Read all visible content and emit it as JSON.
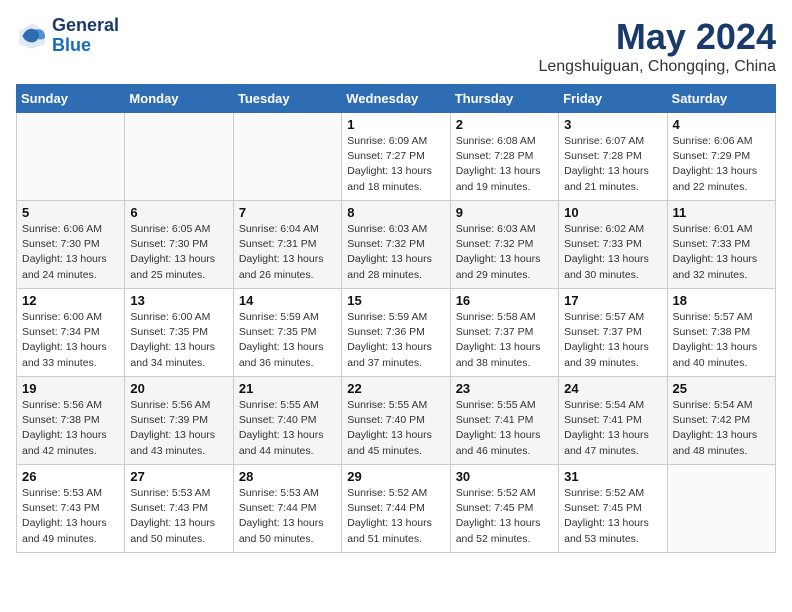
{
  "header": {
    "logo_line1": "General",
    "logo_line2": "Blue",
    "month_year": "May 2024",
    "location": "Lengshuiguan, Chongqing, China"
  },
  "days_of_week": [
    "Sunday",
    "Monday",
    "Tuesday",
    "Wednesday",
    "Thursday",
    "Friday",
    "Saturday"
  ],
  "weeks": [
    [
      {
        "day": "",
        "info": ""
      },
      {
        "day": "",
        "info": ""
      },
      {
        "day": "",
        "info": ""
      },
      {
        "day": "1",
        "info": "Sunrise: 6:09 AM\nSunset: 7:27 PM\nDaylight: 13 hours\nand 18 minutes."
      },
      {
        "day": "2",
        "info": "Sunrise: 6:08 AM\nSunset: 7:28 PM\nDaylight: 13 hours\nand 19 minutes."
      },
      {
        "day": "3",
        "info": "Sunrise: 6:07 AM\nSunset: 7:28 PM\nDaylight: 13 hours\nand 21 minutes."
      },
      {
        "day": "4",
        "info": "Sunrise: 6:06 AM\nSunset: 7:29 PM\nDaylight: 13 hours\nand 22 minutes."
      }
    ],
    [
      {
        "day": "5",
        "info": "Sunrise: 6:06 AM\nSunset: 7:30 PM\nDaylight: 13 hours\nand 24 minutes."
      },
      {
        "day": "6",
        "info": "Sunrise: 6:05 AM\nSunset: 7:30 PM\nDaylight: 13 hours\nand 25 minutes."
      },
      {
        "day": "7",
        "info": "Sunrise: 6:04 AM\nSunset: 7:31 PM\nDaylight: 13 hours\nand 26 minutes."
      },
      {
        "day": "8",
        "info": "Sunrise: 6:03 AM\nSunset: 7:32 PM\nDaylight: 13 hours\nand 28 minutes."
      },
      {
        "day": "9",
        "info": "Sunrise: 6:03 AM\nSunset: 7:32 PM\nDaylight: 13 hours\nand 29 minutes."
      },
      {
        "day": "10",
        "info": "Sunrise: 6:02 AM\nSunset: 7:33 PM\nDaylight: 13 hours\nand 30 minutes."
      },
      {
        "day": "11",
        "info": "Sunrise: 6:01 AM\nSunset: 7:33 PM\nDaylight: 13 hours\nand 32 minutes."
      }
    ],
    [
      {
        "day": "12",
        "info": "Sunrise: 6:00 AM\nSunset: 7:34 PM\nDaylight: 13 hours\nand 33 minutes."
      },
      {
        "day": "13",
        "info": "Sunrise: 6:00 AM\nSunset: 7:35 PM\nDaylight: 13 hours\nand 34 minutes."
      },
      {
        "day": "14",
        "info": "Sunrise: 5:59 AM\nSunset: 7:35 PM\nDaylight: 13 hours\nand 36 minutes."
      },
      {
        "day": "15",
        "info": "Sunrise: 5:59 AM\nSunset: 7:36 PM\nDaylight: 13 hours\nand 37 minutes."
      },
      {
        "day": "16",
        "info": "Sunrise: 5:58 AM\nSunset: 7:37 PM\nDaylight: 13 hours\nand 38 minutes."
      },
      {
        "day": "17",
        "info": "Sunrise: 5:57 AM\nSunset: 7:37 PM\nDaylight: 13 hours\nand 39 minutes."
      },
      {
        "day": "18",
        "info": "Sunrise: 5:57 AM\nSunset: 7:38 PM\nDaylight: 13 hours\nand 40 minutes."
      }
    ],
    [
      {
        "day": "19",
        "info": "Sunrise: 5:56 AM\nSunset: 7:38 PM\nDaylight: 13 hours\nand 42 minutes."
      },
      {
        "day": "20",
        "info": "Sunrise: 5:56 AM\nSunset: 7:39 PM\nDaylight: 13 hours\nand 43 minutes."
      },
      {
        "day": "21",
        "info": "Sunrise: 5:55 AM\nSunset: 7:40 PM\nDaylight: 13 hours\nand 44 minutes."
      },
      {
        "day": "22",
        "info": "Sunrise: 5:55 AM\nSunset: 7:40 PM\nDaylight: 13 hours\nand 45 minutes."
      },
      {
        "day": "23",
        "info": "Sunrise: 5:55 AM\nSunset: 7:41 PM\nDaylight: 13 hours\nand 46 minutes."
      },
      {
        "day": "24",
        "info": "Sunrise: 5:54 AM\nSunset: 7:41 PM\nDaylight: 13 hours\nand 47 minutes."
      },
      {
        "day": "25",
        "info": "Sunrise: 5:54 AM\nSunset: 7:42 PM\nDaylight: 13 hours\nand 48 minutes."
      }
    ],
    [
      {
        "day": "26",
        "info": "Sunrise: 5:53 AM\nSunset: 7:43 PM\nDaylight: 13 hours\nand 49 minutes."
      },
      {
        "day": "27",
        "info": "Sunrise: 5:53 AM\nSunset: 7:43 PM\nDaylight: 13 hours\nand 50 minutes."
      },
      {
        "day": "28",
        "info": "Sunrise: 5:53 AM\nSunset: 7:44 PM\nDaylight: 13 hours\nand 50 minutes."
      },
      {
        "day": "29",
        "info": "Sunrise: 5:52 AM\nSunset: 7:44 PM\nDaylight: 13 hours\nand 51 minutes."
      },
      {
        "day": "30",
        "info": "Sunrise: 5:52 AM\nSunset: 7:45 PM\nDaylight: 13 hours\nand 52 minutes."
      },
      {
        "day": "31",
        "info": "Sunrise: 5:52 AM\nSunset: 7:45 PM\nDaylight: 13 hours\nand 53 minutes."
      },
      {
        "day": "",
        "info": ""
      }
    ]
  ]
}
